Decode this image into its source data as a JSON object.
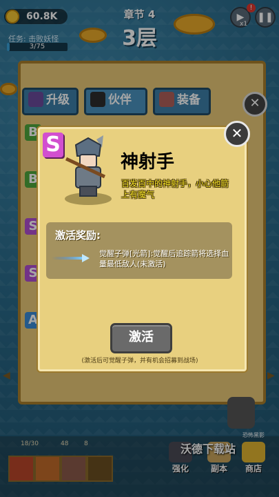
{
  "hud": {
    "gold": "60.8K",
    "task_label": "任务: 击败妖怪",
    "task_progress": "3/75",
    "task_fraction": 0.04,
    "chapter": "章节 4",
    "floor": "3层",
    "speed_label": "x1",
    "alert_badge": "!"
  },
  "tabs": [
    {
      "label": "升级",
      "icon": "hat-icon"
    },
    {
      "label": "伙伴",
      "icon": "partner-icon"
    },
    {
      "label": "装备",
      "icon": "boot-icon"
    }
  ],
  "dialog": {
    "rank": "S",
    "hero_name": "神射手",
    "hero_desc": "百发百中的神射手，小心他箭上有魔气",
    "reward_title": "激活奖励:",
    "reward_desc": "觉醒子弹[光箭]:觉醒后追踪箭将选择血量最低敌人(未激活)",
    "activate_label": "激活",
    "hint": "(激活后可觉醒子弹，并有机会招募到战场)"
  },
  "bottom": {
    "stat1": "18/30",
    "stat2": "48",
    "stat3": "8",
    "btn_strengthen": "强化",
    "btn_dungeon": "副本",
    "btn_shop": "商店",
    "npc_label": "恐怖黑影"
  },
  "watermark": "沃德下载站",
  "colors": {
    "dialog_bg": "#e8d07f",
    "rank_purple": "#d24fcf",
    "desc_yellow": "#f3e128",
    "tab_blue": "#3d7fa8"
  }
}
